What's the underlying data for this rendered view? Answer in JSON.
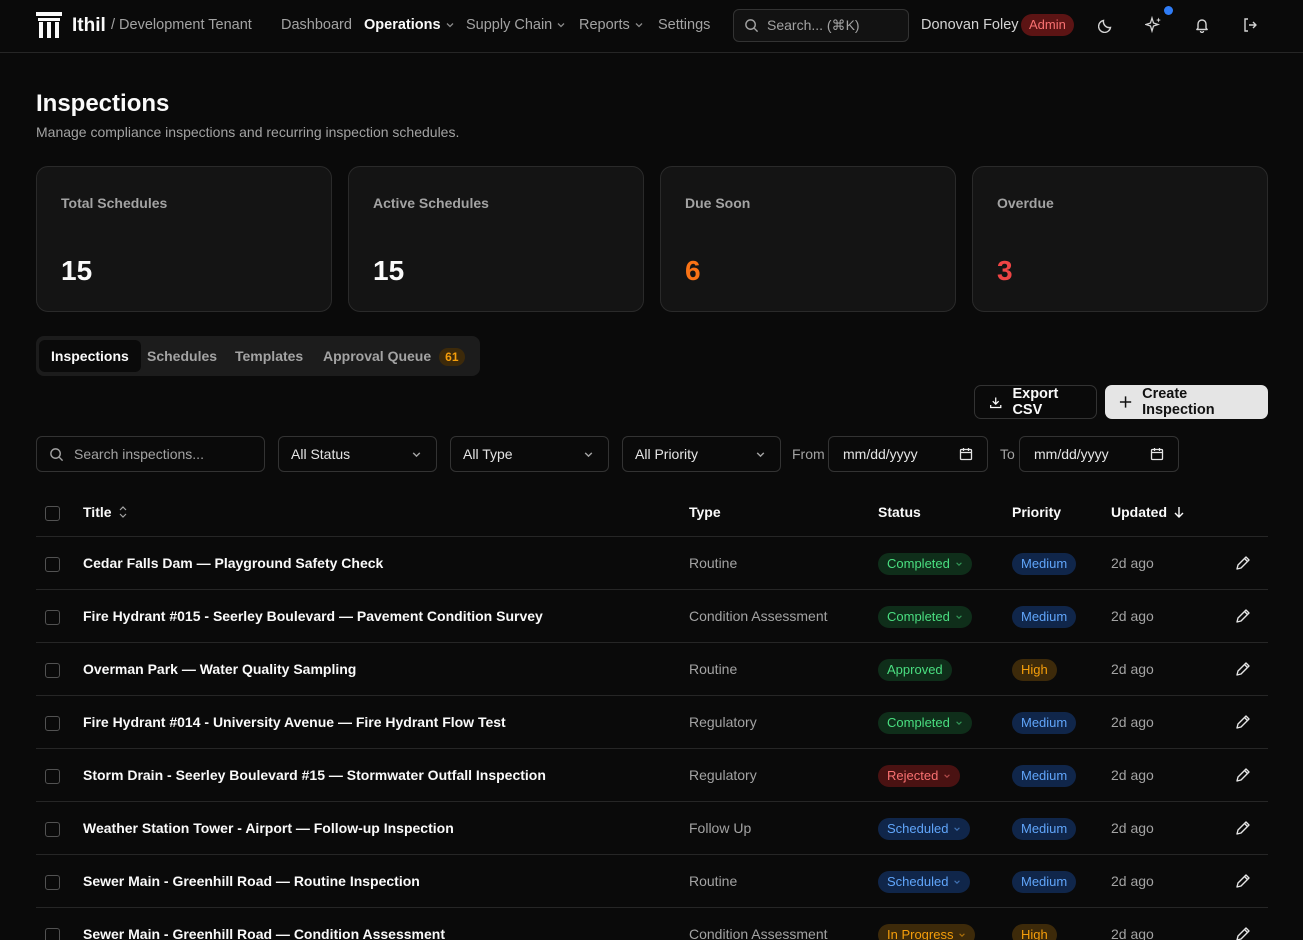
{
  "app": {
    "brand": "Ithil",
    "tenant": "/ Development Tenant"
  },
  "nav": {
    "items": [
      {
        "label": "Dashboard",
        "active": false,
        "dropdown": false
      },
      {
        "label": "Operations",
        "active": true,
        "dropdown": true
      },
      {
        "label": "Supply Chain",
        "active": false,
        "dropdown": true
      },
      {
        "label": "Reports",
        "active": false,
        "dropdown": true
      },
      {
        "label": "Settings",
        "active": false,
        "dropdown": false
      }
    ],
    "search_placeholder": "Search... (⌘K)",
    "user_name": "Donovan Foley",
    "user_role": "Admin"
  },
  "page": {
    "title": "Inspections",
    "subtitle": "Manage compliance inspections and recurring inspection schedules."
  },
  "stats": [
    {
      "label": "Total Schedules",
      "value": "15",
      "color": "#fafafa"
    },
    {
      "label": "Active Schedules",
      "value": "15",
      "color": "#fafafa"
    },
    {
      "label": "Due Soon",
      "value": "6",
      "color": "#f97316"
    },
    {
      "label": "Overdue",
      "value": "3",
      "color": "#ef4444"
    }
  ],
  "tabs": [
    {
      "label": "Inspections",
      "active": true
    },
    {
      "label": "Schedules",
      "active": false
    },
    {
      "label": "Templates",
      "active": false
    },
    {
      "label": "Approval Queue",
      "active": false,
      "count": "61"
    }
  ],
  "actions": {
    "export_label": "Export CSV",
    "create_label": "Create Inspection"
  },
  "filters": {
    "search_placeholder": "Search inspections...",
    "status": "All Status",
    "type": "All Type",
    "priority": "All Priority",
    "from_label": "From",
    "to_label": "To",
    "date_placeholder": "mm/dd/yyyy"
  },
  "table": {
    "columns": {
      "title": "Title",
      "type": "Type",
      "status": "Status",
      "priority": "Priority",
      "updated": "Updated"
    },
    "rows": [
      {
        "title": "Cedar Falls Dam — Playground Safety Check",
        "type": "Routine",
        "status": "Completed",
        "status_dropdown": true,
        "priority": "Medium",
        "updated": "2d ago"
      },
      {
        "title": "Fire Hydrant #015 - Seerley Boulevard — Pavement Condition Survey",
        "type": "Condition Assessment",
        "status": "Completed",
        "status_dropdown": true,
        "priority": "Medium",
        "updated": "2d ago"
      },
      {
        "title": "Overman Park — Water Quality Sampling",
        "type": "Routine",
        "status": "Approved",
        "status_dropdown": false,
        "priority": "High",
        "updated": "2d ago"
      },
      {
        "title": "Fire Hydrant #014 - University Avenue — Fire Hydrant Flow Test",
        "type": "Regulatory",
        "status": "Completed",
        "status_dropdown": true,
        "priority": "Medium",
        "updated": "2d ago"
      },
      {
        "title": "Storm Drain - Seerley Boulevard #15 — Stormwater Outfall Inspection",
        "type": "Regulatory",
        "status": "Rejected",
        "status_dropdown": true,
        "priority": "Medium",
        "updated": "2d ago"
      },
      {
        "title": "Weather Station Tower - Airport — Follow-up Inspection",
        "type": "Follow Up",
        "status": "Scheduled",
        "status_dropdown": true,
        "priority": "Medium",
        "updated": "2d ago"
      },
      {
        "title": "Sewer Main - Greenhill Road — Routine Inspection",
        "type": "Routine",
        "status": "Scheduled",
        "status_dropdown": true,
        "priority": "Medium",
        "updated": "2d ago"
      },
      {
        "title": "Sewer Main - Greenhill Road — Condition Assessment",
        "type": "Condition Assessment",
        "status": "In Progress",
        "status_dropdown": true,
        "priority": "High",
        "updated": "2d ago"
      }
    ]
  },
  "status_colors": {
    "Completed": {
      "bg": "#0f2e1a",
      "fg": "#4ade80"
    },
    "Approved": {
      "bg": "#0f2e1a",
      "fg": "#4ade80"
    },
    "Rejected": {
      "bg": "#4a1212",
      "fg": "#f87171"
    },
    "Scheduled": {
      "bg": "#10264a",
      "fg": "#60a5fa"
    },
    "In Progress": {
      "bg": "#3d2a0a",
      "fg": "#f59e0b"
    }
  },
  "priority_colors": {
    "Medium": {
      "bg": "#10264a",
      "fg": "#60a5fa"
    },
    "High": {
      "bg": "#3d2a0a",
      "fg": "#f59e0b"
    }
  },
  "icons": [
    "app-logo",
    "chevron-down-icon",
    "search-icon",
    "moon-icon",
    "sparkles-icon",
    "bell-icon",
    "logout-icon",
    "download-icon",
    "plus-icon",
    "calendar-icon",
    "sort-icon",
    "sort-down-icon",
    "pencil-icon"
  ]
}
